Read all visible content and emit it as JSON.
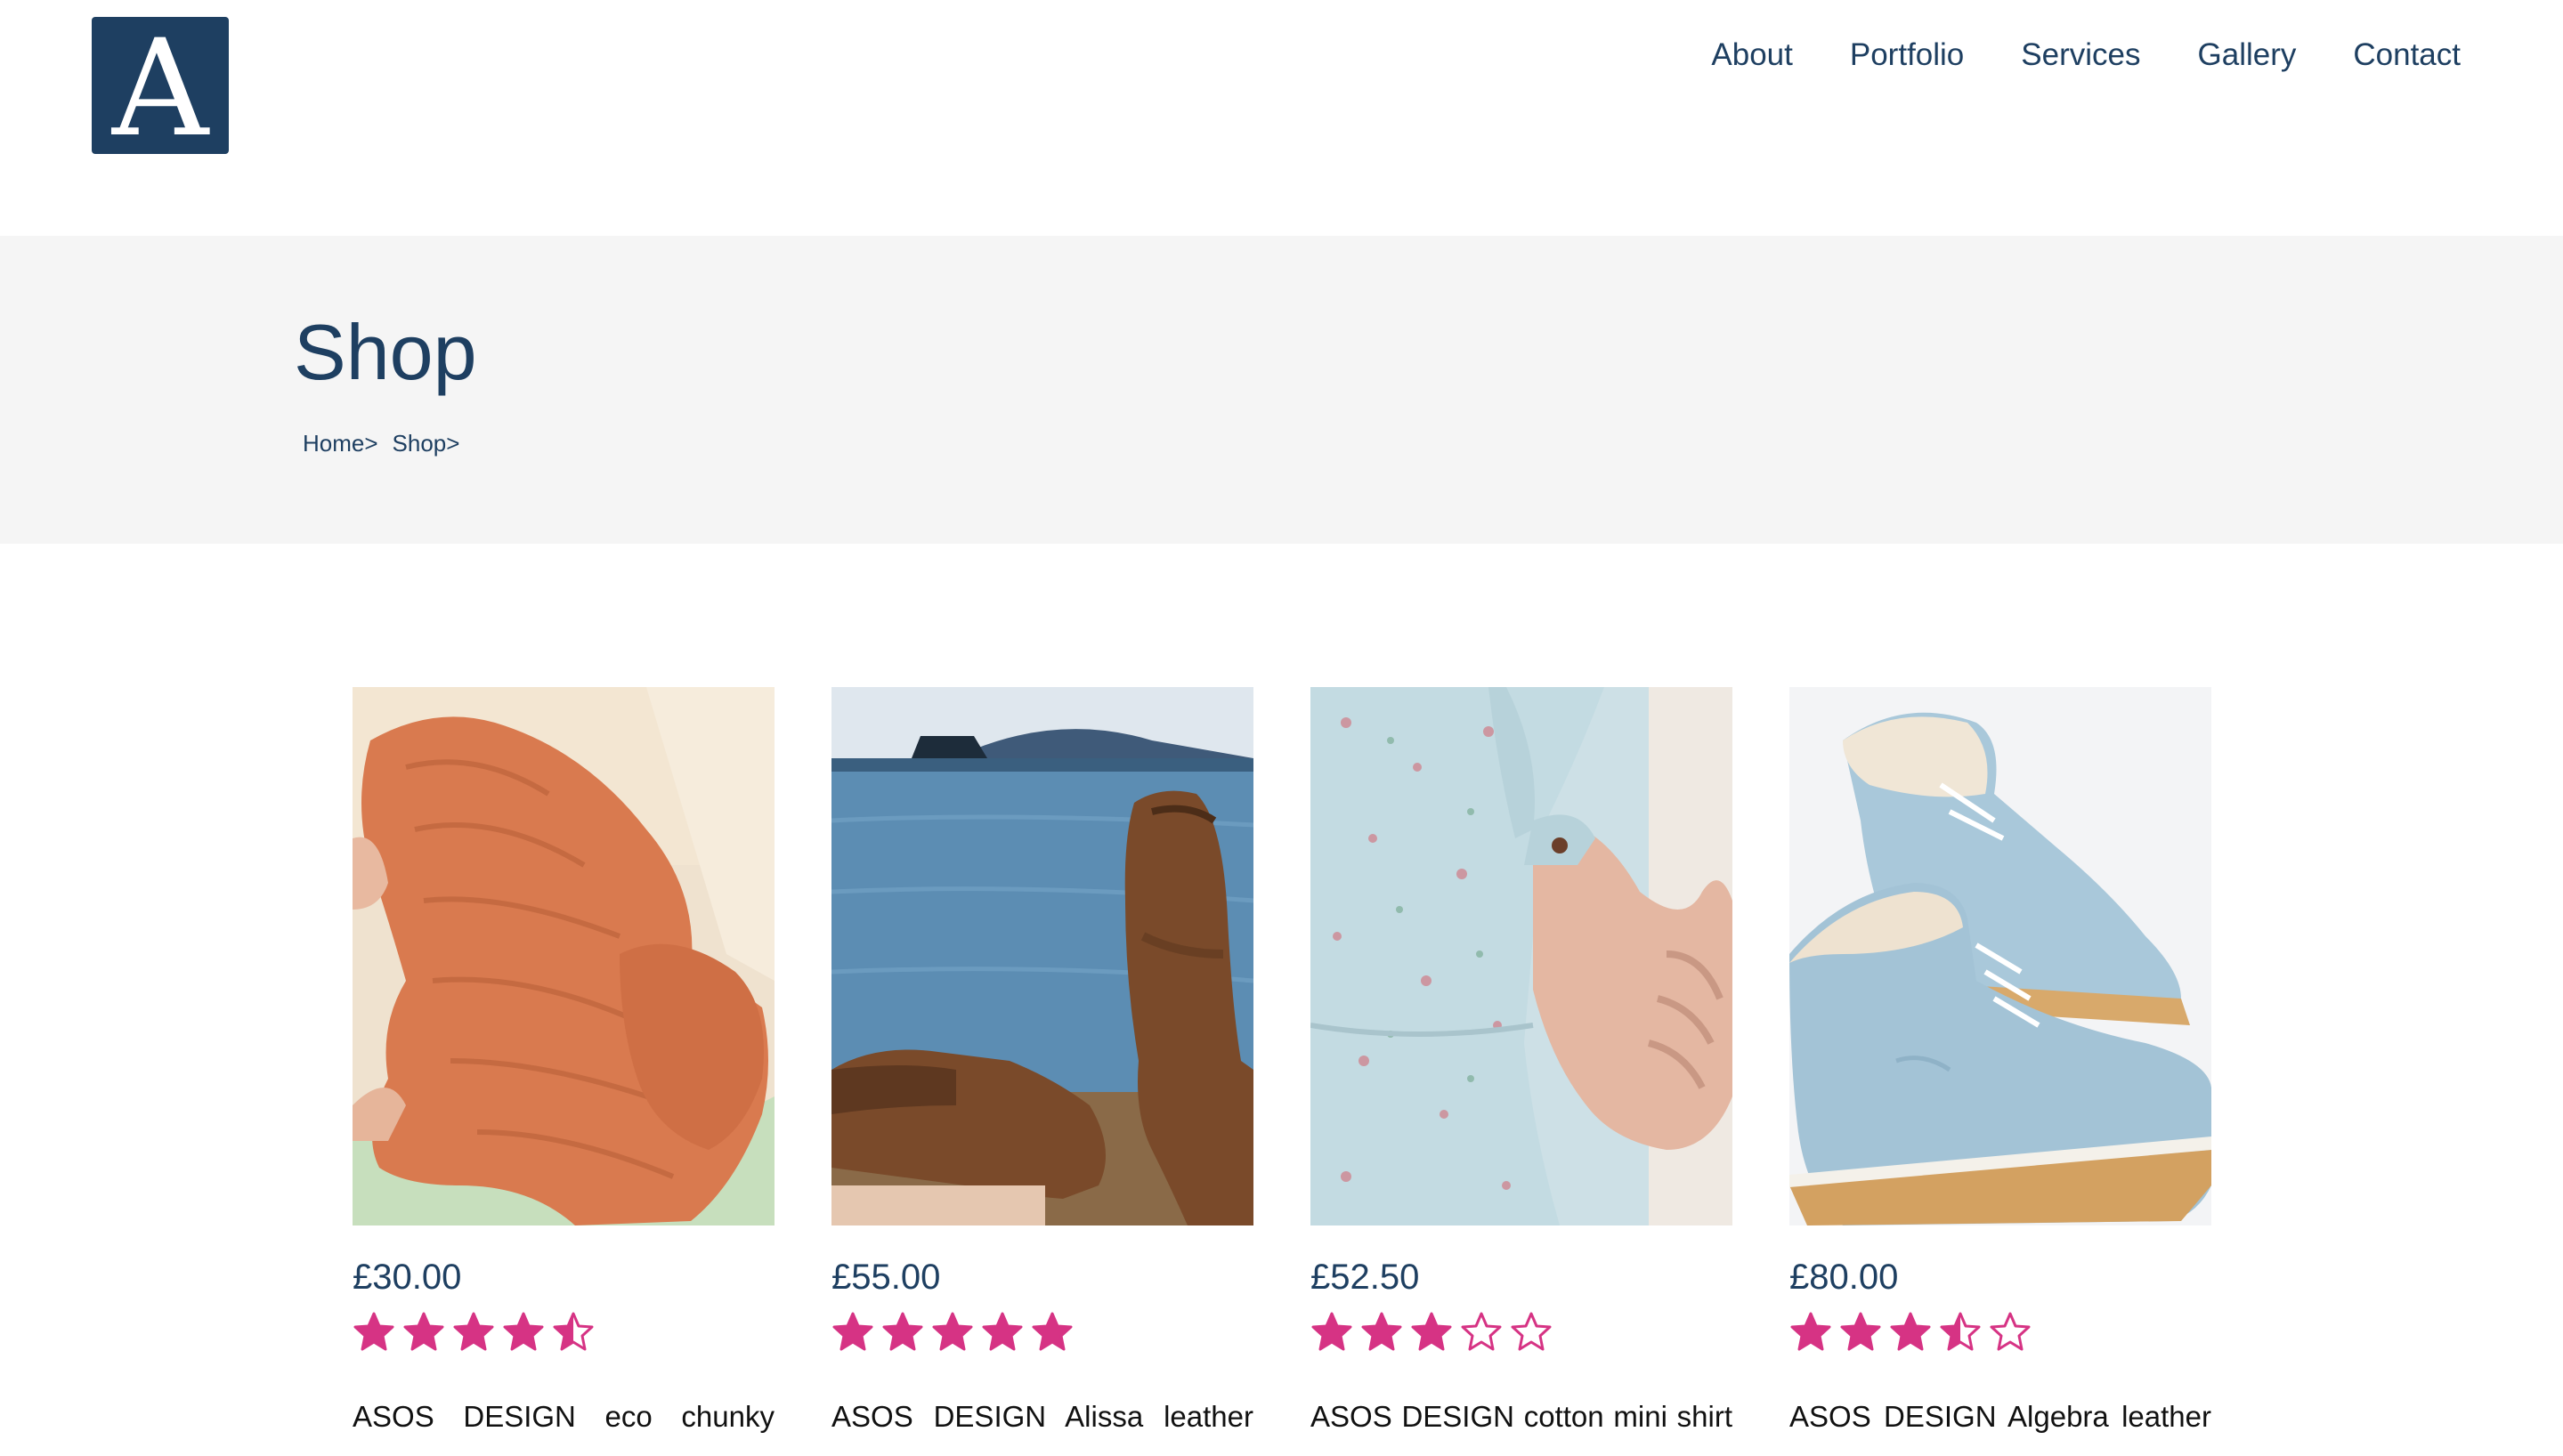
{
  "brand": {
    "logo_letter": "A",
    "logo_color": "#1e3f61"
  },
  "nav": {
    "items": [
      "About",
      "Portfolio",
      "Services",
      "Gallery",
      "Contact"
    ]
  },
  "hero": {
    "title": "Shop",
    "breadcrumb": [
      "Home>",
      "Shop>"
    ],
    "background": "#f5f5f5"
  },
  "accent_color": "#d63384",
  "products": [
    {
      "price": "£30.00",
      "rating": 4.5,
      "description": "ASOS DESIGN eco chunky",
      "image": "orange-knit-sweater"
    },
    {
      "price": "£55.00",
      "rating": 5,
      "description": "ASOS DESIGN Alissa leather",
      "image": "brown-leather-boots"
    },
    {
      "price": "£52.50",
      "rating": 3,
      "description": "ASOS DESIGN cotton mini shirt",
      "image": "floral-blue-shirt-dress"
    },
    {
      "price": "£80.00",
      "rating": 3.5,
      "description": "ASOS DESIGN Algebra leather",
      "image": "light-blue-lace-up-boots"
    }
  ]
}
